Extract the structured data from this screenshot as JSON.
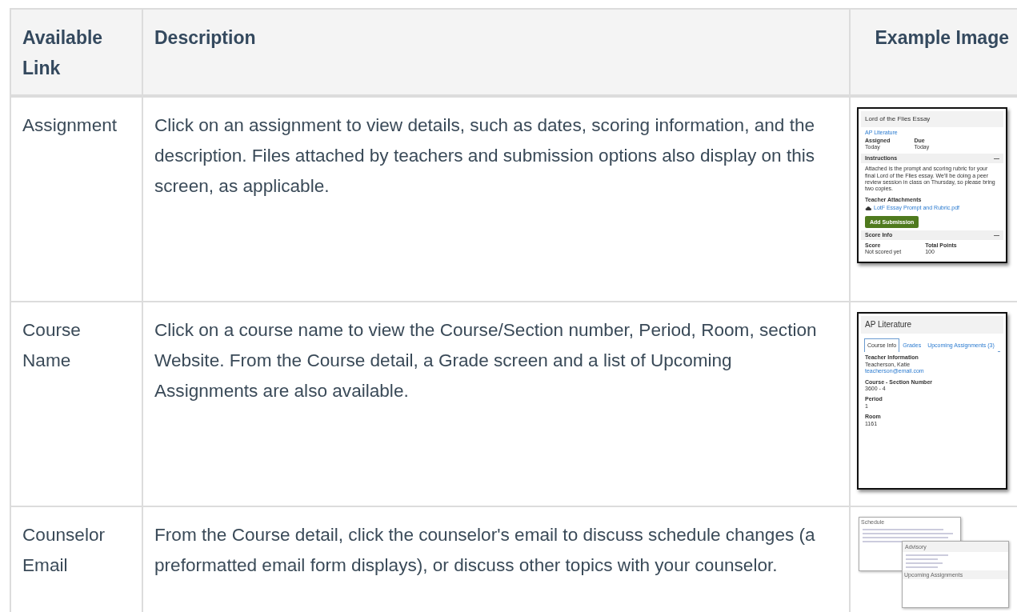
{
  "table": {
    "columns": [
      "Available Link",
      "Description",
      "Example Image"
    ],
    "rows": [
      {
        "link": "Assignment",
        "description": "Click on an assignment to view details, such as dates, scoring information, and the description. Files attached by teachers and submission options also display on this screen, as applicable.",
        "example": {
          "kind": "assignment",
          "title": "Lord of the Flies Essay",
          "course": "AP Literature",
          "dates": [
            {
              "label": "Assigned",
              "value": "Today"
            },
            {
              "label": "Due",
              "value": "Today"
            }
          ],
          "instructions_heading": "Instructions",
          "instructions_toggle": "—",
          "instructions": "Attached is the prompt and scoring rubric for your final Lord of the Flies essay. We'll be doing a peer review session in class on Thursday, so please bring two copies.",
          "attachments_label": "Teacher Attachments",
          "attachment": "LotF Essay Prompt and Rubric.pdf",
          "button": "Add Submission",
          "score_heading": "Score Info",
          "score_toggle": "—",
          "scores": [
            {
              "label": "Score",
              "value": "Not scored yet"
            },
            {
              "label": "Total Points",
              "value": "100"
            }
          ]
        }
      },
      {
        "link": "Course Name",
        "description": "Click on a course name to view the Course/Section number, Period, Room, section Website. From the Course detail, a Grade screen and a list of Upcoming Assignments are also available.",
        "example": {
          "kind": "course",
          "title": "AP Literature",
          "tabs": [
            {
              "label": "Course Info",
              "selected": true
            },
            {
              "label": "Grades",
              "selected": false
            },
            {
              "label": "Upcoming Assignments (3)",
              "selected": false
            }
          ],
          "teacher_label": "Teacher Information",
          "teacher": "Teacherson, Katie",
          "email": "teacherson@email.com",
          "fields": [
            {
              "label": "Course - Section Number",
              "value": "3600 - 4"
            },
            {
              "label": "Period",
              "value": "1"
            },
            {
              "label": "Room",
              "value": "1161"
            }
          ]
        }
      },
      {
        "link": "Counselor Email",
        "description": "From the Course detail, click the counselor's email to discuss schedule changes (a preformatted email form displays), or discuss other topics with your counselor.",
        "example": {
          "kind": "counselor",
          "back_title": "Schedule",
          "front_title": "Advisory",
          "footer": "Upcoming Assignments"
        }
      }
    ]
  }
}
